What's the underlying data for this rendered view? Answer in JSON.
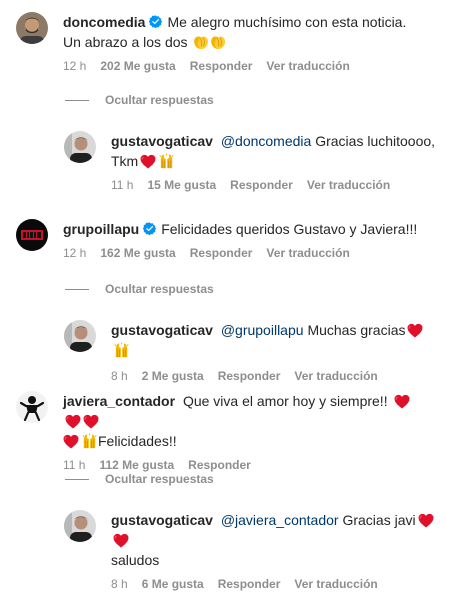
{
  "comments": [
    {
      "username": "doncomedia",
      "verified": true,
      "text": "Me alegro muchísimo con esta noticia. Un abrazo a los dos",
      "emoji": "clapping-hands x2",
      "time": "12 h",
      "likes": "202 Me gusta",
      "reply": "Responder",
      "translate": "Ver traducción",
      "hide_replies": "Ocultar respuestas",
      "replies": [
        {
          "username": "gustavogaticav",
          "mention": "@doncomedia",
          "text": "Gracias luchitoooo,",
          "text2": "Tkm",
          "emoji": "red-heart, raising-hands",
          "time": "11 h",
          "likes": "15 Me gusta",
          "reply": "Responder",
          "translate": "Ver traducción"
        }
      ]
    },
    {
      "username": "grupoillapu",
      "verified": true,
      "text": "Felicidades queridos Gustavo y Javiera!!!",
      "time": "12 h",
      "likes": "162 Me gusta",
      "reply": "Responder",
      "translate": "Ver traducción",
      "hide_replies": "Ocultar respuestas",
      "replies": [
        {
          "username": "gustavogaticav",
          "mention": "@grupoillapu",
          "text": "Muchas gracias",
          "emoji": "red-heart, raising-hands",
          "time": "8 h",
          "likes": "2 Me gusta",
          "reply": "Responder",
          "translate": "Ver traducción"
        }
      ]
    },
    {
      "username": "javiera_contador",
      "verified": false,
      "text": "Que viva el amor hoy y siempre!!",
      "text2": "Felicidades!!",
      "emoji": "red-heart x4, raising-hands",
      "time": "11 h",
      "likes": "112 Me gusta",
      "reply": "Responder",
      "hide_replies": "Ocultar respuestas",
      "replies": [
        {
          "username": "gustavogaticav",
          "mention": "@javiera_contador",
          "text": "Gracias javi",
          "text2": "saludos",
          "emoji": "red-heart x2",
          "time": "8 h",
          "likes": "6 Me gusta",
          "reply": "Responder",
          "translate": "Ver traducción"
        }
      ]
    }
  ]
}
